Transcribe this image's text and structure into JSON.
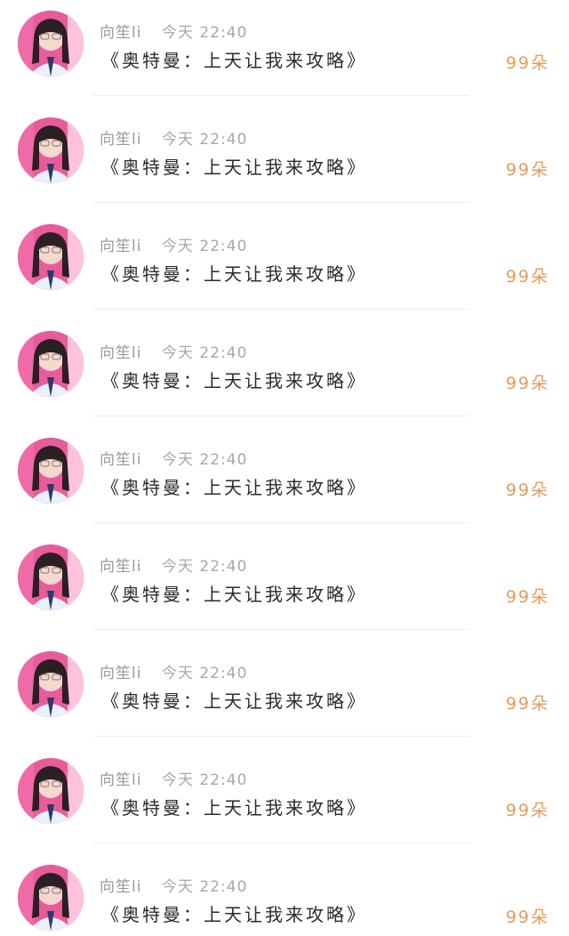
{
  "rows": [
    {
      "username": "向笙li",
      "time": "今天 22:40",
      "message": "《奥特曼：上天让我来攻略》",
      "count": "99朵"
    },
    {
      "username": "向笙li",
      "time": "今天 22:40",
      "message": "《奥特曼：上天让我来攻略》",
      "count": "99朵"
    },
    {
      "username": "向笙li",
      "time": "今天 22:40",
      "message": "《奥特曼：上天让我来攻略》",
      "count": "99朵"
    },
    {
      "username": "向笙li",
      "time": "今天 22:40",
      "message": "《奥特曼：上天让我来攻略》",
      "count": "99朵"
    },
    {
      "username": "向笙li",
      "time": "今天 22:40",
      "message": "《奥特曼：上天让我来攻略》",
      "count": "99朵"
    },
    {
      "username": "向笙li",
      "time": "今天 22:40",
      "message": "《奥特曼：上天让我来攻略》",
      "count": "99朵"
    },
    {
      "username": "向笙li",
      "time": "今天 22:40",
      "message": "《奥特曼：上天让我来攻略》",
      "count": "99朵"
    },
    {
      "username": "向笙li",
      "time": "今天 22:40",
      "message": "《奥特曼：上天让我来攻略》",
      "count": "99朵"
    },
    {
      "username": "向笙li",
      "time": "今天 22:40",
      "message": "《奥特曼：上天让我来攻略》",
      "count": "99朵"
    }
  ],
  "colors": {
    "username": "#9a9a9a",
    "time": "#a8a8a8",
    "message": "#2b2b2b",
    "count": "#e89a5a",
    "divider": "#ededed"
  },
  "icons": {
    "avatar": "user-avatar-photo"
  }
}
